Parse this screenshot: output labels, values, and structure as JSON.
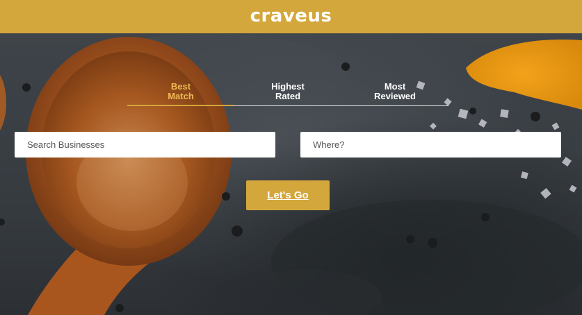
{
  "header": {
    "logo": "craveus"
  },
  "tabs": [
    {
      "line1": "Best",
      "line2": "Match",
      "active": true
    },
    {
      "line1": "Highest",
      "line2": "Rated",
      "active": false
    },
    {
      "line1": "Most",
      "line2": "Reviewed",
      "active": false
    }
  ],
  "search": {
    "business_placeholder": "Search Businesses",
    "location_placeholder": "Where?",
    "business_value": "",
    "location_value": ""
  },
  "submit": {
    "label": "Let's Go"
  },
  "colors": {
    "brand": "#d4a73c",
    "active_tab": "#eeb954",
    "background": "#2f3338"
  }
}
